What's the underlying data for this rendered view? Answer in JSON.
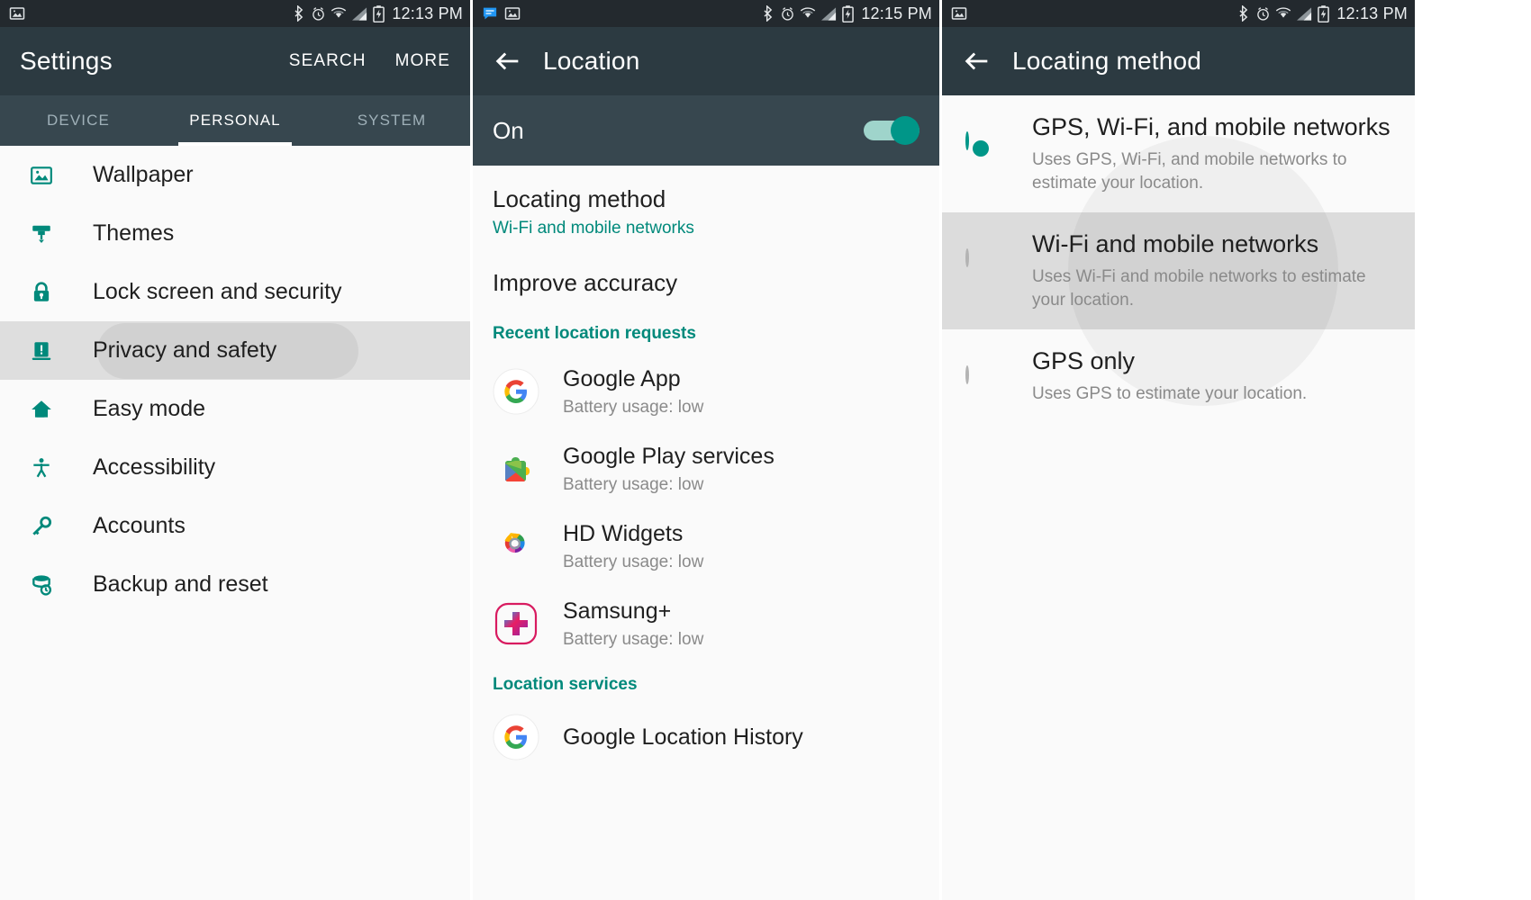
{
  "theme": {
    "accent": "#009688",
    "statusbar_bg": "#23292e",
    "actionbar_bg": "#2c3a41",
    "tabbar_bg": "#37474f",
    "page_bg": "#fafafa",
    "selected_row_bg": "#dedede",
    "link_green": "#00897b",
    "secondary_text": "#8a8a8a"
  },
  "panel1": {
    "statusbar": {
      "time": "12:13 PM",
      "left_icons": [
        "image-icon"
      ],
      "right_icons": [
        "bluetooth-icon",
        "alarm-icon",
        "wifi-icon",
        "signal-icon",
        "battery-charging-icon"
      ]
    },
    "actionbar": {
      "title": "Settings",
      "actions": [
        {
          "label": "SEARCH",
          "name": "search-action"
        },
        {
          "label": "MORE",
          "name": "more-action"
        }
      ]
    },
    "tabs": [
      {
        "label": "DEVICE",
        "active": false
      },
      {
        "label": "PERSONAL",
        "active": true
      },
      {
        "label": "SYSTEM",
        "active": false
      }
    ],
    "items": [
      {
        "label": "Wallpaper",
        "icon": "wallpaper-icon",
        "selected": false
      },
      {
        "label": "Themes",
        "icon": "themes-icon",
        "selected": false
      },
      {
        "label": "Lock screen and security",
        "icon": "lock-icon",
        "selected": false
      },
      {
        "label": "Privacy and safety",
        "icon": "privacy-icon",
        "selected": true
      },
      {
        "label": "Easy mode",
        "icon": "easy-mode-icon",
        "selected": false
      },
      {
        "label": "Accessibility",
        "icon": "accessibility-icon",
        "selected": false
      },
      {
        "label": "Accounts",
        "icon": "accounts-key-icon",
        "selected": false
      },
      {
        "label": "Backup and reset",
        "icon": "backup-reset-icon",
        "selected": false
      }
    ]
  },
  "panel2": {
    "statusbar": {
      "time": "12:15 PM",
      "left_icons": [
        "message-icon",
        "image-icon"
      ],
      "right_icons": [
        "bluetooth-icon",
        "alarm-icon",
        "wifi-icon",
        "signal-icon",
        "battery-charging-icon"
      ]
    },
    "actionbar": {
      "title": "Location",
      "back": "back-arrow-icon"
    },
    "master_switch": {
      "label": "On",
      "state": "on"
    },
    "locating_method": {
      "title": "Locating method",
      "value": "Wi-Fi and mobile networks"
    },
    "improve_accuracy": {
      "title": "Improve accuracy"
    },
    "recent_requests_header": "Recent location requests",
    "recent_requests": [
      {
        "name": "Google App",
        "sub": "Battery usage: low",
        "icon": "google-g-icon"
      },
      {
        "name": "Google Play services",
        "sub": "Battery usage: low",
        "icon": "google-play-services-icon"
      },
      {
        "name": "HD Widgets",
        "sub": "Battery usage: low",
        "icon": "hd-widgets-icon"
      },
      {
        "name": "Samsung+",
        "sub": "Battery usage: low",
        "icon": "samsung-plus-icon"
      }
    ],
    "location_services_header": "Location services",
    "location_services": [
      {
        "name": "Google Location History",
        "icon": "google-g-icon"
      }
    ]
  },
  "panel3": {
    "statusbar": {
      "time": "12:13 PM",
      "left_icons": [
        "image-icon"
      ],
      "right_icons": [
        "bluetooth-icon",
        "alarm-icon",
        "wifi-icon",
        "signal-icon",
        "battery-charging-icon"
      ]
    },
    "actionbar": {
      "title": "Locating method",
      "back": "back-arrow-icon"
    },
    "options": [
      {
        "title": "GPS, Wi-Fi, and mobile networks",
        "desc": "Uses GPS, Wi-Fi, and mobile networks to estimate your location.",
        "checked": true,
        "highlight": false
      },
      {
        "title": "Wi-Fi and mobile networks",
        "desc": "Uses Wi-Fi and mobile networks to estimate your location.",
        "checked": false,
        "highlight": true
      },
      {
        "title": "GPS only",
        "desc": "Uses GPS to estimate your location.",
        "checked": false,
        "highlight": false
      }
    ]
  }
}
